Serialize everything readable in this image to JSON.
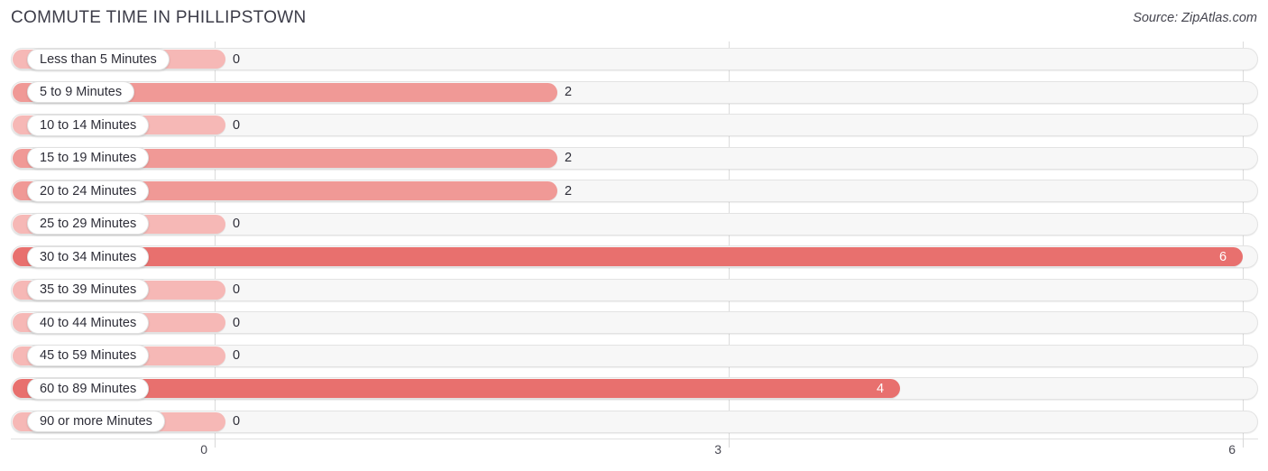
{
  "header": {
    "title": "COMMUTE TIME IN PHILLIPSTOWN",
    "source": "Source: ZipAtlas.com"
  },
  "colors": {
    "bar_zero": "#f6b8b6",
    "bar_low": "#f09996",
    "bar_high": "#e8706e",
    "track": "#f7f7f7",
    "gridline": "#dcdcdc",
    "text": "#2e2e38"
  },
  "chart_data": {
    "type": "bar",
    "orientation": "horizontal",
    "title": "COMMUTE TIME IN PHILLIPSTOWN",
    "xlabel": "",
    "ylabel": "",
    "xlim": [
      0,
      6
    ],
    "xticks": [
      "0",
      "3",
      "6"
    ],
    "xtick_values": [
      0,
      3,
      6
    ],
    "grid": true,
    "legend": false,
    "categories": [
      "Less than 5 Minutes",
      "5 to 9 Minutes",
      "10 to 14 Minutes",
      "15 to 19 Minutes",
      "20 to 24 Minutes",
      "25 to 29 Minutes",
      "30 to 34 Minutes",
      "35 to 39 Minutes",
      "40 to 44 Minutes",
      "45 to 59 Minutes",
      "60 to 89 Minutes",
      "90 or more Minutes"
    ],
    "values": [
      0,
      2,
      0,
      2,
      2,
      0,
      6,
      0,
      0,
      0,
      4,
      0
    ],
    "value_labels": [
      "0",
      "2",
      "0",
      "2",
      "2",
      "0",
      "6",
      "0",
      "0",
      "0",
      "4",
      "0"
    ]
  },
  "rows": [
    {
      "label": "Less than 5 Minutes",
      "value": 0,
      "value_label": "0",
      "label_inside": false
    },
    {
      "label": "5 to 9 Minutes",
      "value": 2,
      "value_label": "2",
      "label_inside": false
    },
    {
      "label": "10 to 14 Minutes",
      "value": 0,
      "value_label": "0",
      "label_inside": false
    },
    {
      "label": "15 to 19 Minutes",
      "value": 2,
      "value_label": "2",
      "label_inside": false
    },
    {
      "label": "20 to 24 Minutes",
      "value": 2,
      "value_label": "2",
      "label_inside": false
    },
    {
      "label": "25 to 29 Minutes",
      "value": 0,
      "value_label": "0",
      "label_inside": false
    },
    {
      "label": "30 to 34 Minutes",
      "value": 6,
      "value_label": "6",
      "label_inside": true
    },
    {
      "label": "35 to 39 Minutes",
      "value": 0,
      "value_label": "0",
      "label_inside": false
    },
    {
      "label": "40 to 44 Minutes",
      "value": 0,
      "value_label": "0",
      "label_inside": false
    },
    {
      "label": "45 to 59 Minutes",
      "value": 0,
      "value_label": "0",
      "label_inside": false
    },
    {
      "label": "60 to 89 Minutes",
      "value": 4,
      "value_label": "4",
      "label_inside": true
    },
    {
      "label": "90 or more Minutes",
      "value": 0,
      "value_label": "0",
      "label_inside": false
    }
  ]
}
